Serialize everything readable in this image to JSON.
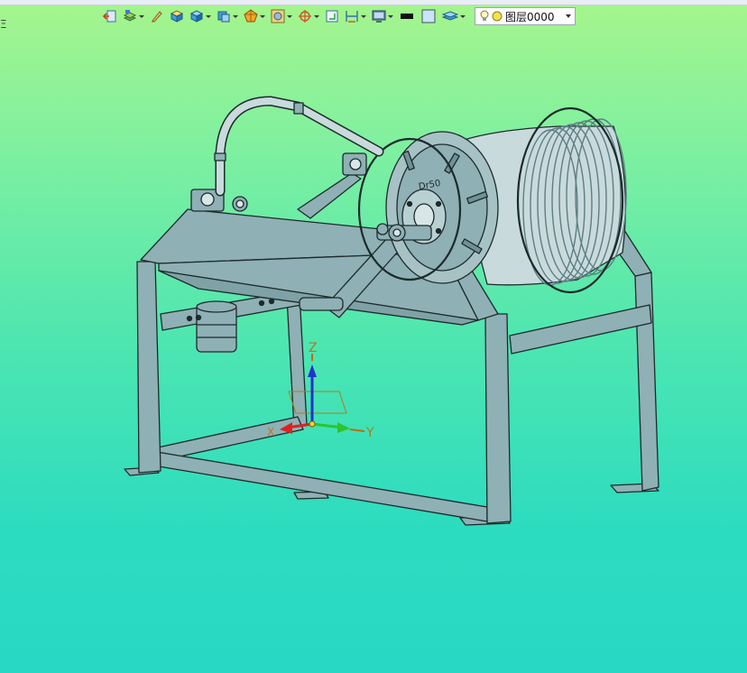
{
  "edge_fragment": "Ξ",
  "toolbar": {
    "buttons": [
      {
        "icon": "exit-sketch-icon",
        "dropdown": false
      },
      {
        "icon": "layer-stack-icon",
        "dropdown": true
      },
      {
        "icon": "pencil-icon",
        "dropdown": false
      },
      {
        "icon": "box-yellow-icon",
        "dropdown": false
      },
      {
        "icon": "box-blue-icon",
        "dropdown": true
      },
      {
        "icon": "view-cube-icon",
        "dropdown": true
      },
      {
        "icon": "orange-selection-icon",
        "dropdown": true
      },
      {
        "icon": "render-style-icon",
        "dropdown": true
      },
      {
        "icon": "snap-target-icon",
        "dropdown": true
      },
      {
        "icon": "work-plane-icon",
        "dropdown": false
      },
      {
        "icon": "dimension-icon",
        "dropdown": true
      },
      {
        "icon": "display-icon",
        "dropdown": true
      },
      {
        "icon": "black-color-swatch-icon",
        "dropdown": false
      },
      {
        "icon": "light-color-swatch-icon",
        "dropdown": false
      },
      {
        "icon": "layers-icon",
        "dropdown": true
      }
    ],
    "layer_selector": {
      "value": "图层0000",
      "bulb_icon": "bulb-icon",
      "dot_icon": "layer-color-dot-icon"
    }
  },
  "axes": {
    "x_label": "X",
    "y_label": "Y",
    "z_label": "Z"
  },
  "model": {
    "drum_label": "Dr50"
  },
  "colors": {
    "background_top": "#a6f58c",
    "background_bottom": "#28d8c4",
    "part_fill": "#8fb0b4",
    "part_stroke": "#1c2a2c",
    "x_axis": "#e02020",
    "y_axis": "#2fc42f",
    "z_axis": "#2233cc",
    "axis_label": "#b07a20"
  }
}
